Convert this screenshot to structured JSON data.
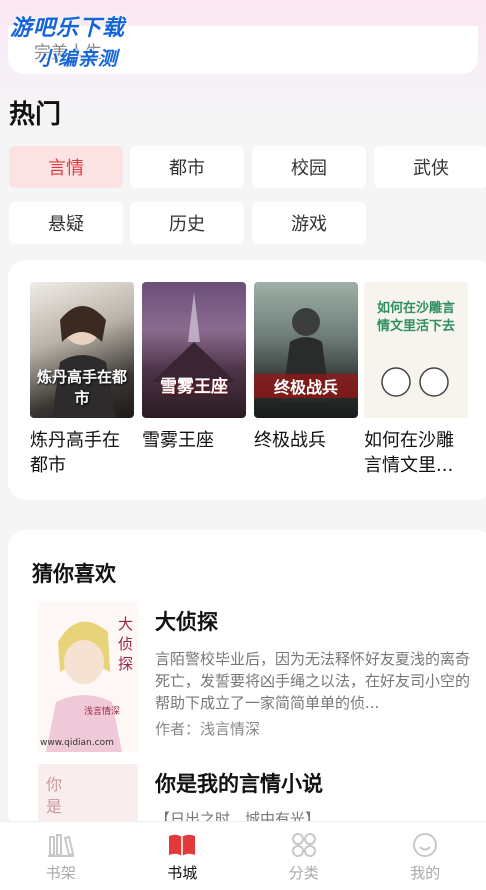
{
  "watermark": {
    "line1": "游吧乐下载",
    "line2": "小编亲测"
  },
  "search": {
    "placeholder": "完美人生"
  },
  "hot": {
    "title": "热门",
    "tags": [
      "言情",
      "都市",
      "校园",
      "武侠",
      "悬疑",
      "历史",
      "游戏"
    ],
    "active_index": 0
  },
  "featured": [
    {
      "title": "炼丹高手在都市",
      "cover_text": "炼丹高手在都市"
    },
    {
      "title": "雪雾王座",
      "cover_text": "雪雾王座"
    },
    {
      "title": "终极战兵",
      "cover_text": "终极战兵"
    },
    {
      "title": "如何在沙雕言情文里...",
      "cover_text": "如何在沙雕言情文里活下去"
    }
  ],
  "guess": {
    "title": "猜你喜欢",
    "items": [
      {
        "title": "大侦探",
        "desc": "言陌警校毕业后，因为无法释怀好友夏浅的离奇死亡，发誓要将凶手绳之以法，在好友司小空的帮助下成立了一家简简单单的侦...",
        "author": "作者：浅言情深",
        "cover_text": "大侦探",
        "cover_sub": "浅言情深",
        "cover_site": "www.qidian.com"
      },
      {
        "title": "你是我的言情小说",
        "desc": "【日出之时，城中有光】",
        "cover_text": "你是"
      }
    ]
  },
  "tabbar": {
    "tabs": [
      {
        "label": "书架",
        "icon": "bookshelf-icon"
      },
      {
        "label": "书城",
        "icon": "book-open-icon"
      },
      {
        "label": "分类",
        "icon": "grid-icon"
      },
      {
        "label": "我的",
        "icon": "smile-icon"
      }
    ],
    "active_index": 1
  },
  "colors": {
    "accent": "#e23a3a",
    "active_tag_bg": "#fbe3e3"
  }
}
